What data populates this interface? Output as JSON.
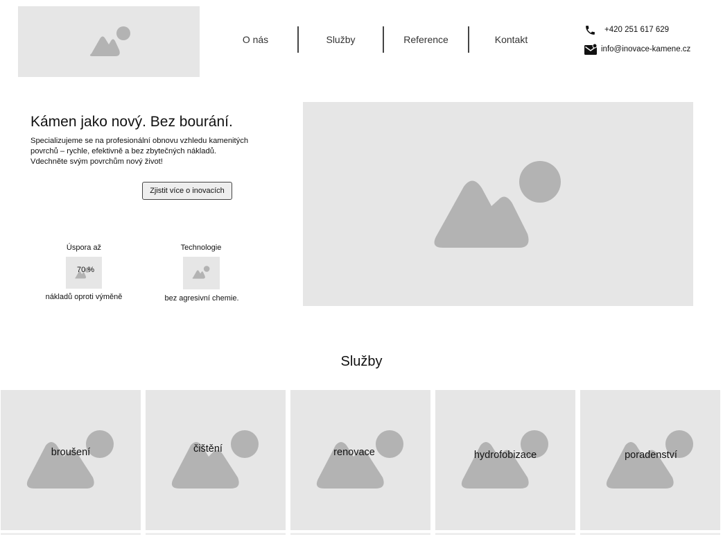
{
  "header": {
    "logo_icon": "image-placeholder-icon",
    "nav": [
      {
        "label": "O nás"
      },
      {
        "label": "Služby"
      },
      {
        "label": "Reference"
      },
      {
        "label": "Kontakt"
      }
    ],
    "contact": {
      "phone": "+420 251 617 629",
      "phone_icon": "phone-icon",
      "email": "info@inovace-kamene.cz",
      "email_icon": "mail-icon"
    }
  },
  "hero": {
    "title": "Kámen jako nový. Bez bourání.",
    "text_lines": [
      "Specializujeme se na profesionální obnovu vzhledu kamenitých",
      "povrchů – rychle, efektivně a bez zbytečných nákladů.",
      "Vdechněte svým povrchům nový život!"
    ],
    "cta_label": "Zjistit více o inovacích",
    "image_icon": "image-placeholder-icon"
  },
  "features": [
    {
      "title": "Úspora až",
      "value": "70 %",
      "caption": "nákladů oproti výměně"
    },
    {
      "title": "Technologie",
      "value": "",
      "caption": "bez agresivní chemie."
    }
  ],
  "services": {
    "title": "Služby",
    "items": [
      {
        "label": "broušení"
      },
      {
        "label": "čištění"
      },
      {
        "label": "renovace"
      },
      {
        "label": "hydrofobizace"
      },
      {
        "label": "poradenství"
      }
    ]
  },
  "colors": {
    "placeholder_bg": "#e6e6e6",
    "placeholder_shape": "#b3b3b3",
    "nav_separator": "#444444"
  }
}
